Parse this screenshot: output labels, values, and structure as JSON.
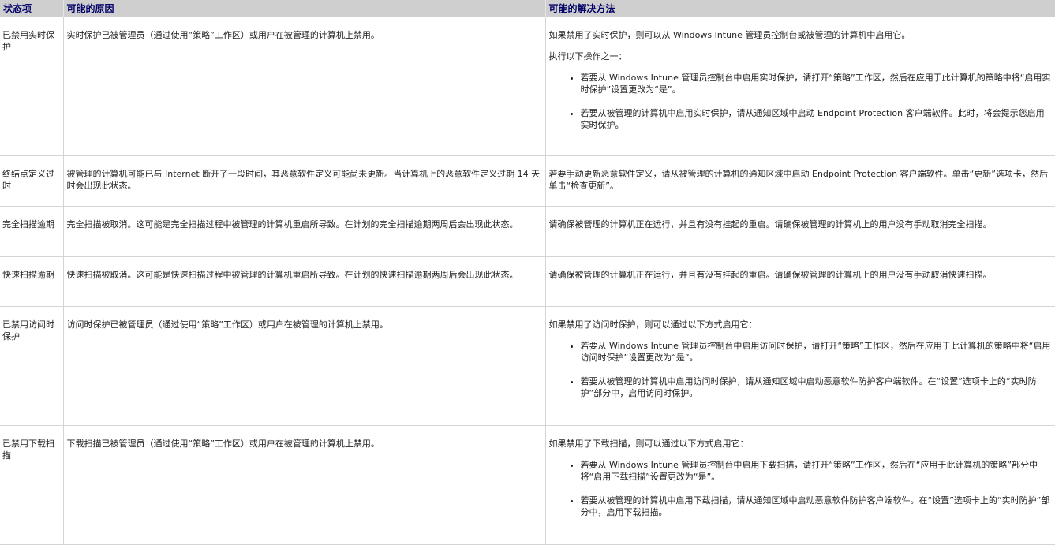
{
  "headers": [
    "状态项",
    "可能的原因",
    "可能的解决方法"
  ],
  "rows": [
    {
      "status": "已禁用实时保护",
      "cause": "实时保护已被管理员（通过使用“策略”工作区）或用户在被管理的计算机上禁用。",
      "solution": {
        "intro": "如果禁用了实时保护，则可以从 Windows Intune 管理员控制台或被管理的计算机中启用它。",
        "lead": "执行以下操作之一：",
        "bullets": [
          "若要从 Windows Intune 管理员控制台中启用实时保护，请打开“策略”工作区，然后在应用于此计算机的策略中将“启用实时保护”设置更改为“是”。",
          "若要从被管理的计算机中启用实时保护，请从通知区域中启动 Endpoint Protection 客户端软件。此时，将会提示您启用实时保护。"
        ]
      }
    },
    {
      "status": "终结点定义过时",
      "cause": "被管理的计算机可能已与 Internet 断开了一段时间，其恶意软件定义可能尚未更新。当计算机上的恶意软件定义过期 14 天时会出现此状态。",
      "solution": {
        "intro": "若要手动更新恶意软件定义，请从被管理的计算机的通知区域中启动 Endpoint Protection 客户端软件。单击“更新”选项卡，然后单击“检查更新”。"
      }
    },
    {
      "status": "完全扫描逾期",
      "cause": "完全扫描被取消。这可能是完全扫描过程中被管理的计算机重启所导致。在计划的完全扫描逾期两周后会出现此状态。",
      "solution": {
        "intro": "请确保被管理的计算机正在运行，并且有没有挂起的重启。请确保被管理的计算机上的用户没有手动取消完全扫描。"
      }
    },
    {
      "status": "快速扫描逾期",
      "cause": "快速扫描被取消。这可能是快速扫描过程中被管理的计算机重启所导致。在计划的快速扫描逾期两周后会出现此状态。",
      "solution": {
        "intro": "请确保被管理的计算机正在运行，并且有没有挂起的重启。请确保被管理的计算机上的用户没有手动取消快速扫描。"
      }
    },
    {
      "status": "已禁用访问时保护",
      "cause": "访问时保护已被管理员（通过使用“策略”工作区）或用户在被管理的计算机上禁用。",
      "solution": {
        "intro": "如果禁用了访问时保护，则可以通过以下方式启用它：",
        "bullets": [
          "若要从 Windows Intune 管理员控制台中启用访问时保护，请打开“策略”工作区，然后在应用于此计算机的策略中将“启用访问时保护”设置更改为“是”。",
          "若要从被管理的计算机中启用访问时保护，请从通知区域中启动恶意软件防护客户端软件。在“设置”选项卡上的“实时防护”部分中，启用访问时保护。"
        ]
      }
    },
    {
      "status": "已禁用下载扫描",
      "cause": "下载扫描已被管理员（通过使用“策略”工作区）或用户在被管理的计算机上禁用。",
      "solution": {
        "intro": "如果禁用了下载扫描，则可以通过以下方式启用它：",
        "bullets": [
          "若要从 Windows Intune 管理员控制台中启用下载扫描，请打开“策略”工作区，然后在“应用于此计算机的策略”部分中将“启用下载扫描”设置更改为“是”。",
          "若要从被管理的计算机中启用下载扫描，请从通知区域中启动恶意软件防护客户端软件。在“设置”选项卡上的“实时防护”部分中，启用下载扫描。"
        ]
      }
    }
  ]
}
